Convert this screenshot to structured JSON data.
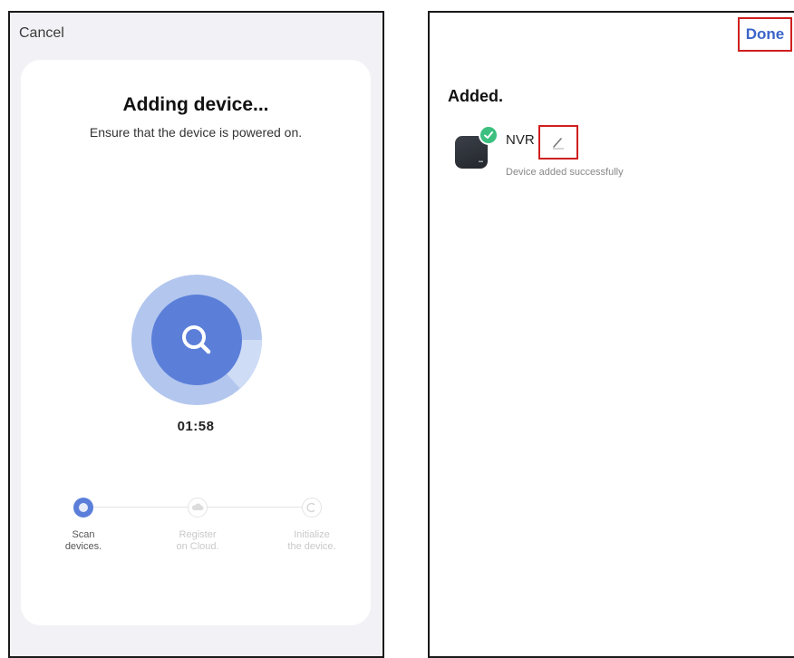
{
  "left_screen": {
    "cancel_label": "Cancel",
    "title": "Adding device...",
    "subtitle": "Ensure that the device is powered on.",
    "timer": "01:58",
    "search_icon": "search-icon",
    "steps": [
      {
        "label_line1": "Scan",
        "label_line2": "devices.",
        "state": "active",
        "icon": "scan-icon"
      },
      {
        "label_line1": "Register",
        "label_line2": "on Cloud.",
        "state": "pending",
        "icon": "cloud-icon"
      },
      {
        "label_line1": "Initialize",
        "label_line2": "the device.",
        "state": "pending",
        "icon": "initialize-icon"
      }
    ]
  },
  "right_screen": {
    "done_label": "Done",
    "heading": "Added.",
    "device": {
      "name": "NVR",
      "status": "Device added successfully",
      "icon": "nvr-device-icon",
      "badge_icon": "checkmark-icon",
      "edit_icon": "pencil-icon"
    }
  },
  "colors": {
    "accent_blue": "#5b7fd9",
    "link_blue": "#3b64c8",
    "highlight_red": "#d01f1f",
    "success_green": "#3cbf7f"
  }
}
